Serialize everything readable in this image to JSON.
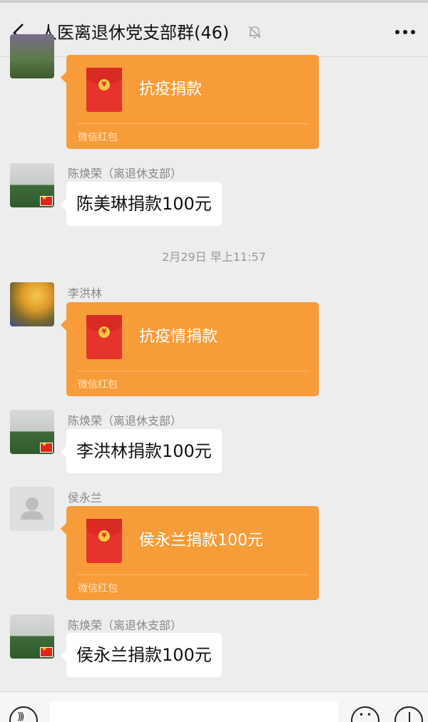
{
  "header": {
    "title": "人医离退休党支部群(46)",
    "back_icon": "chevron-left-icon",
    "mute_icon": "bell-off-icon",
    "more_icon": "ellipsis-icon"
  },
  "messages": [
    {
      "type": "redpacket",
      "sender": "",
      "avatar": "crowd-photo",
      "packet_title": "抗疫捐款",
      "packet_label": "微信红包"
    },
    {
      "type": "text",
      "sender": "陈焕荣（离退休支部）",
      "avatar": "field-photo",
      "text": "陈美琳捐款100元"
    },
    {
      "type": "timestamp",
      "text": "2月29日 早上11:57"
    },
    {
      "type": "redpacket",
      "sender": "李洪林",
      "avatar": "tree-photo",
      "packet_title": "抗疫情捐款",
      "packet_label": "微信红包"
    },
    {
      "type": "text",
      "sender": "陈焕荣（离退休支部）",
      "avatar": "field-photo",
      "text": "李洪林捐款100元"
    },
    {
      "type": "redpacket",
      "sender": "侯永兰",
      "avatar": "default-avatar",
      "packet_title": "侯永兰捐款100元",
      "packet_label": "微信红包"
    },
    {
      "type": "text",
      "sender": "陈焕荣（离退休支部）",
      "avatar": "field-photo",
      "text": "侯永兰捐款100元"
    }
  ],
  "input_bar": {
    "voice_icon": "voice-icon",
    "emoji_icon": "emoji-icon",
    "plus_icon": "plus-icon",
    "placeholder": ""
  },
  "colors": {
    "background": "#ededed",
    "redpacket": "#f79c38",
    "bubble": "#ffffff",
    "envelope": "#e5342c"
  }
}
